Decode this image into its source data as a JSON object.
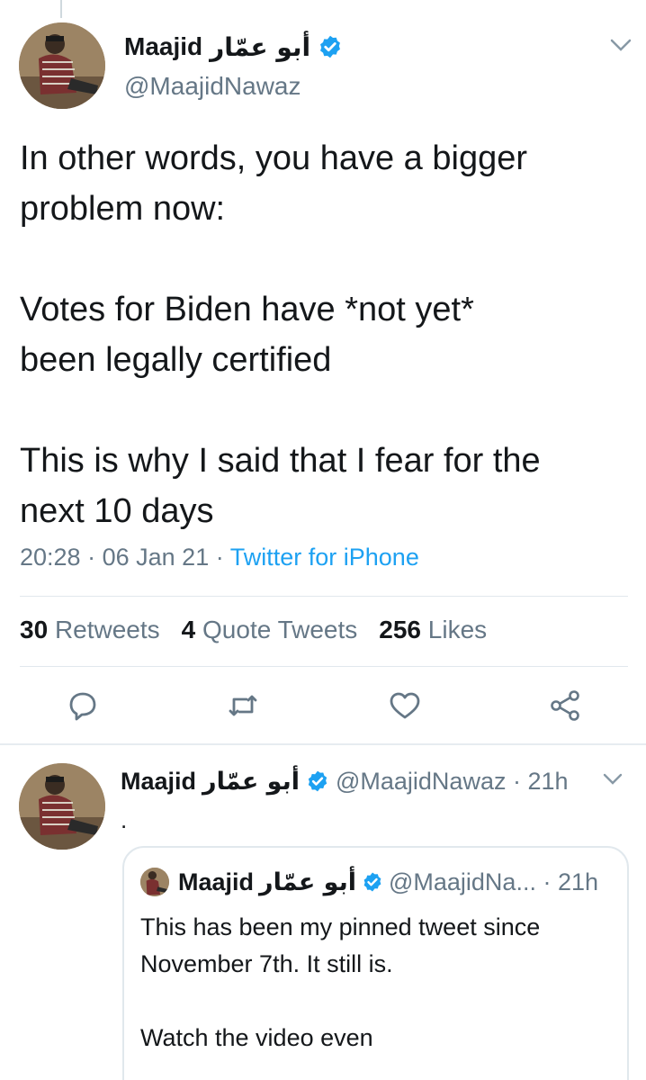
{
  "main_tweet": {
    "author": {
      "name": "Maajid",
      "name_arabic": "أبو عمّار",
      "handle": "@MaajidNawaz",
      "verified": true
    },
    "text_lines": [
      "In other words, you have a bigger",
      "problem now:",
      "",
      "Votes for Biden have *not yet*",
      "been legally certified",
      "",
      "This is why I said that I fear for the",
      "next 10 days"
    ],
    "time": "20:28",
    "separator": "·",
    "date": "06 Jan 21",
    "source": "Twitter for iPhone",
    "stats": {
      "retweets_count": "30",
      "retweets_label": "Retweets",
      "quotes_count": "4",
      "quotes_label": "Quote Tweets",
      "likes_count": "256",
      "likes_label": "Likes"
    },
    "actions": [
      "reply-icon",
      "retweet-icon",
      "like-icon",
      "share-icon"
    ]
  },
  "reply_tweet": {
    "author": {
      "name": "Maajid",
      "name_arabic": "أبو عمّار",
      "handle": "@MaajidNawaz",
      "verified": true
    },
    "handle_time": "@MaajidNawaz · 21h",
    "text": ".",
    "quoted_tweet": {
      "author": {
        "name": "Maajid",
        "name_arabic": "أبو عمّار",
        "verified": true
      },
      "handle_time": "@MaajidNa... · 21h",
      "text_lines": [
        "This has been my pinned tweet since",
        "November 7th. It still is.",
        "",
        "Watch the video even",
        "..."
      ]
    }
  },
  "colors": {
    "accent": "#1da1f2",
    "muted": "#657786",
    "text": "#14171a",
    "divider": "#e1e8ed"
  }
}
